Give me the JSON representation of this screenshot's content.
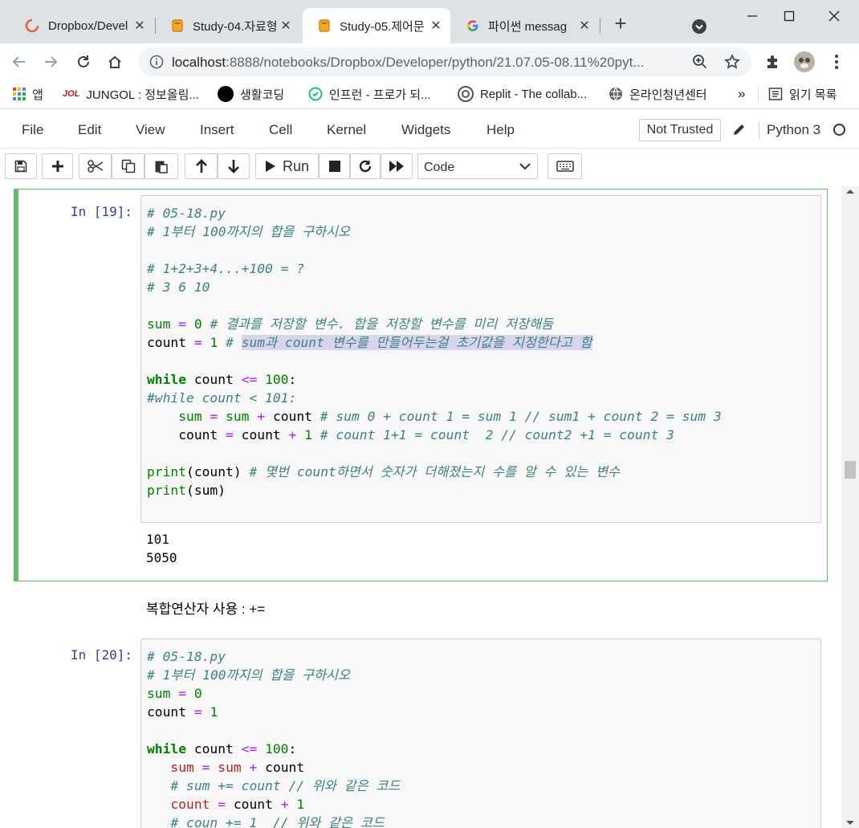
{
  "browser": {
    "tabs": [
      {
        "title": "Dropbox/Devel",
        "icon": "dropbox-icon"
      },
      {
        "title": "Study-04.자료형",
        "icon": "jupyter-notebook-icon"
      },
      {
        "title": "Study-05.제어문",
        "icon": "jupyter-notebook-icon"
      },
      {
        "title": "파이썬 messag",
        "icon": "google-icon"
      }
    ],
    "new_tab": "+",
    "url_host": "localhost",
    "url_rest": ":8888/notebooks/Dropbox/Developer/python/21.07.05-08.11%20pyt...",
    "bookmarks": [
      {
        "label": "앱",
        "icon": "apps-grid-icon"
      },
      {
        "label": "JUNGOL : 정보올림...",
        "icon": "jungol-icon"
      },
      {
        "label": "생활코딩",
        "icon": "black-circle-icon"
      },
      {
        "label": "인프런 - 프로가 되...",
        "icon": "inflearn-icon"
      },
      {
        "label": "Replit - The collab...",
        "icon": "replit-icon"
      },
      {
        "label": "온라인청년센터",
        "icon": "globe-icon"
      }
    ],
    "bookmarks_more": "»",
    "reading_list": "읽기 목록"
  },
  "jupyter": {
    "menu": [
      "File",
      "Edit",
      "View",
      "Insert",
      "Cell",
      "Kernel",
      "Widgets",
      "Help"
    ],
    "trusted": "Not Trusted",
    "kernel": "Python 3",
    "run_label": "Run",
    "cell_type": "Code"
  },
  "cells": [
    {
      "prompt": "In [19]:",
      "outputs": [
        "101",
        "5050"
      ]
    },
    {
      "markdown": "복합연산자 사용 : +="
    },
    {
      "prompt": "In [20]:"
    }
  ],
  "code1": {
    "l1": "# 05-18.py",
    "l2": "# 1부터 100까지의 합을 구하시오",
    "l4": "# 1+2+3+4...+100 = ?",
    "l5": "# 3 6 10",
    "l7_var": "sum",
    "l7_eq": "=",
    "l7_num": "0",
    "l7_com": "# 결과를 저장할 변수. 합을 저장할 변수를 미리 저장해둠",
    "l8_var": "count",
    "l8_eq": "=",
    "l8_num": "1",
    "l8_hash": "#",
    "l8_com": "sum과 count 변수를 만들어두는걸 초기값을 지정한다고 함",
    "l10_kw": "while",
    "l10_var": "count",
    "l10_op": "<=",
    "l10_num": "100",
    "l10_colon": ":",
    "l11": "#while count < 101:",
    "l12_a": "sum",
    "l12_eq": "=",
    "l12_b": "sum",
    "l12_op": "+",
    "l12_c": "count",
    "l12_com": "# sum 0 + count 1 = sum 1 // sum1 + count 2 = sum 3",
    "l13_a": "count",
    "l13_eq": "=",
    "l13_b": "count",
    "l13_op": "+",
    "l13_num": "1",
    "l13_com": "# count 1+1 = count  2 // count2 +1 = count 3",
    "l15_fn": "print",
    "l15_arg": "(count)",
    "l15_com": "# 몇번 count하면서 숫자가 더해졌는지 수를 알 수 있는 변수",
    "l16_fn": "print",
    "l16_arg": "(sum)"
  },
  "code2": {
    "l1": "# 05-18.py",
    "l2": "# 1부터 100까지의 합을 구하시오",
    "l3_var": "sum",
    "l3_eq": "=",
    "l3_num": "0",
    "l4_var": "count",
    "l4_eq": "=",
    "l4_num": "1",
    "l6_kw": "while",
    "l6_var": "count",
    "l6_op": "<=",
    "l6_num": "100",
    "l6_colon": ":",
    "l7_a": "sum",
    "l7_eq": "=",
    "l7_b": "sum",
    "l7_op": "+",
    "l7_c": "count",
    "l8": "# sum += count // 위와 같은 코드",
    "l9_a": "count",
    "l9_eq": "=",
    "l9_b": "count",
    "l9_op": "+",
    "l9_num": "1",
    "l10": "# coun += 1  // 위와 같은 코드"
  }
}
